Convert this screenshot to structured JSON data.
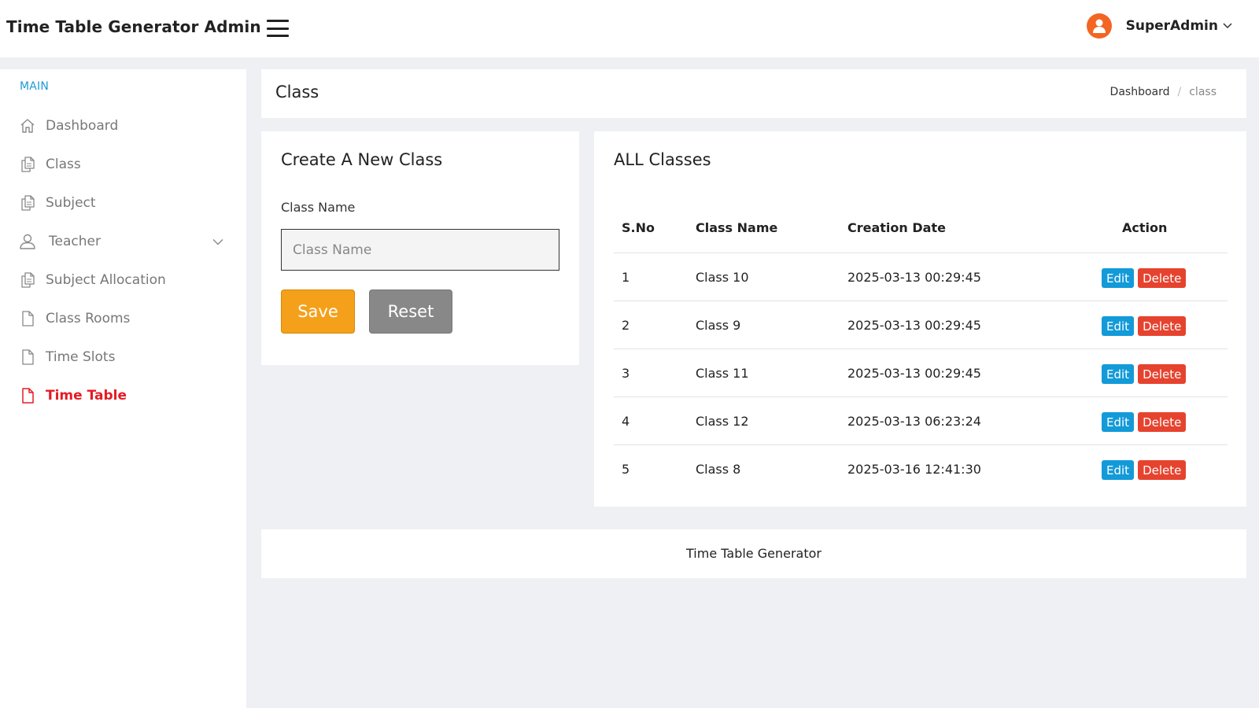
{
  "header": {
    "brand": "Time Table Generator Admin",
    "user_name": "SuperAdmin",
    "icons": {
      "menu": "hamburger-menu-icon",
      "avatar": "user-avatar-icon",
      "caret": "chevron-down-icon"
    },
    "avatar_color": "#f26522"
  },
  "sidebar": {
    "heading": "MAIN",
    "items": [
      {
        "label": "Dashboard",
        "icon": "home-icon"
      },
      {
        "label": "Class",
        "icon": "copy-document-icon"
      },
      {
        "label": "Subject",
        "icon": "copy-document-icon"
      },
      {
        "label": "Teacher",
        "icon": "user-icon",
        "expandable": true
      },
      {
        "label": "Subject Allocation",
        "icon": "copy-document-icon"
      },
      {
        "label": "Class Rooms",
        "icon": "file-icon"
      },
      {
        "label": "Time Slots",
        "icon": "file-icon"
      },
      {
        "label": "Time Table",
        "icon": "file-icon",
        "active": true
      }
    ],
    "heading_color": "#1d9bd6",
    "active_color": "#e51b23"
  },
  "page": {
    "title": "Class",
    "breadcrumb": {
      "home": "Dashboard",
      "current": "class"
    }
  },
  "form": {
    "title": "Create A New Class",
    "label": "Class Name",
    "input_value": "",
    "placeholder": "Class Name",
    "save_label": "Save",
    "reset_label": "Reset",
    "save_color": "#f5a01a",
    "reset_color": "#888888"
  },
  "table": {
    "title": "ALL Classes",
    "columns": [
      "S.No",
      "Class Name",
      "Creation Date",
      "Action"
    ],
    "rows": [
      {
        "sno": "1",
        "name": "Class 10",
        "date": "2025-03-13 00:29:45"
      },
      {
        "sno": "2",
        "name": "Class 9",
        "date": "2025-03-13 00:29:45"
      },
      {
        "sno": "3",
        "name": "Class 11",
        "date": "2025-03-13 00:29:45"
      },
      {
        "sno": "4",
        "name": "Class 12",
        "date": "2025-03-13 06:23:24"
      },
      {
        "sno": "5",
        "name": "Class 8",
        "date": "2025-03-16 12:41:30"
      }
    ],
    "edit_label": "Edit",
    "delete_label": "Delete",
    "edit_color": "#139ad8",
    "delete_color": "#e6432f"
  },
  "footer": {
    "text": "Time Table Generator"
  }
}
